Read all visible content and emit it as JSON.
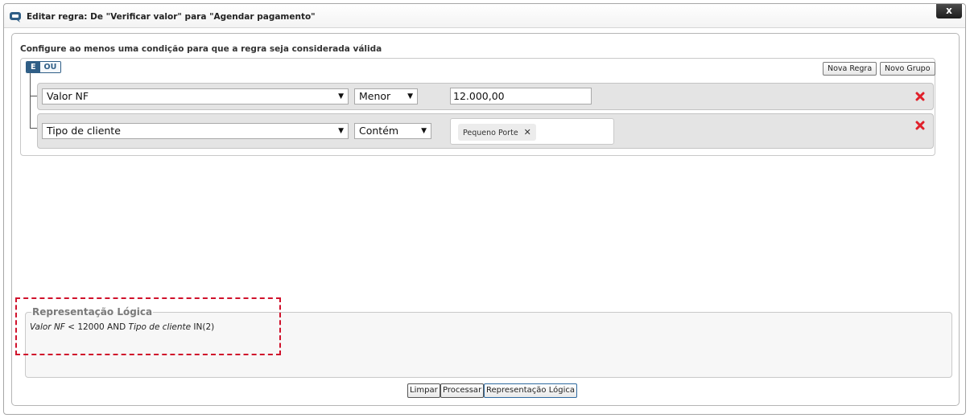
{
  "dialog": {
    "title": "Editar regra: De \"Verificar valor\" para \"Agendar pagamento\"",
    "close_label": "x"
  },
  "editor": {
    "instructions": "Configure ao menos uma condição para que a regra seja considerada válida",
    "group": {
      "toggle_and": "E",
      "toggle_or": "OU",
      "active": "E",
      "add_rule_label": "Nova Regra",
      "add_group_label": "Novo Grupo"
    },
    "rules": [
      {
        "field": "Valor NF",
        "operator": "Menor",
        "value": "12.000,00"
      },
      {
        "field": "Tipo de cliente",
        "operator": "Contém",
        "tags": [
          "Pequeno Porte"
        ],
        "tag_remove": "✕"
      }
    ]
  },
  "logic": {
    "legend": "Representação Lógica",
    "expr_field1": "Valor NF",
    "expr_mid": " < 12000 AND ",
    "expr_field2": "Tipo de cliente",
    "expr_end": " IN(2)"
  },
  "footer": {
    "clear_label": "Limpar",
    "process_label": "Processar",
    "logic_label": "Representação Lógica"
  },
  "colors": {
    "accent": "#2f5e86",
    "highlight": "#d0112b",
    "delete": "#e0202a"
  }
}
